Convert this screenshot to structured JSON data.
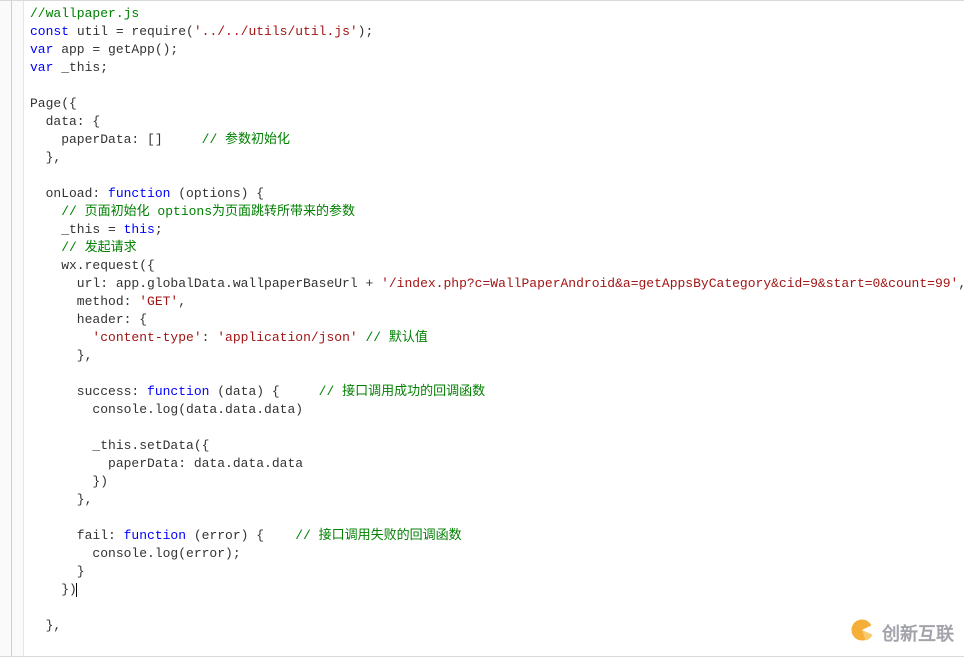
{
  "code": {
    "lines": [
      {
        "tokens": [
          {
            "c": "comment",
            "t": "//wallpaper.js"
          }
        ]
      },
      {
        "tokens": [
          {
            "c": "keyword",
            "t": "const"
          },
          {
            "c": "",
            "t": " util = require("
          },
          {
            "c": "string",
            "t": "'../../utils/util.js'"
          },
          {
            "c": "",
            "t": ");"
          }
        ]
      },
      {
        "tokens": [
          {
            "c": "keyword",
            "t": "var"
          },
          {
            "c": "",
            "t": " app = getApp();"
          }
        ]
      },
      {
        "tokens": [
          {
            "c": "keyword",
            "t": "var"
          },
          {
            "c": "",
            "t": " _this;"
          }
        ]
      },
      {
        "tokens": [
          {
            "c": "",
            "t": ""
          }
        ]
      },
      {
        "tokens": [
          {
            "c": "",
            "t": "Page({"
          }
        ]
      },
      {
        "tokens": [
          {
            "c": "",
            "t": "  data: {"
          }
        ]
      },
      {
        "tokens": [
          {
            "c": "",
            "t": "    paperData: []     "
          },
          {
            "c": "comment",
            "t": "// 参数初始化"
          }
        ]
      },
      {
        "tokens": [
          {
            "c": "",
            "t": "  },"
          }
        ]
      },
      {
        "tokens": [
          {
            "c": "",
            "t": ""
          }
        ]
      },
      {
        "tokens": [
          {
            "c": "",
            "t": "  onLoad: "
          },
          {
            "c": "keyword",
            "t": "function"
          },
          {
            "c": "",
            "t": " (options) {"
          }
        ]
      },
      {
        "tokens": [
          {
            "c": "",
            "t": "    "
          },
          {
            "c": "comment",
            "t": "// 页面初始化 options为页面跳转所带来的参数"
          }
        ]
      },
      {
        "tokens": [
          {
            "c": "",
            "t": "    _this = "
          },
          {
            "c": "keyword",
            "t": "this"
          },
          {
            "c": "",
            "t": ";"
          }
        ]
      },
      {
        "tokens": [
          {
            "c": "",
            "t": "    "
          },
          {
            "c": "comment",
            "t": "// 发起请求"
          }
        ]
      },
      {
        "tokens": [
          {
            "c": "",
            "t": "    wx.request({"
          }
        ]
      },
      {
        "tokens": [
          {
            "c": "",
            "t": "      url: app.globalData.wallpaperBaseUrl + "
          },
          {
            "c": "string",
            "t": "'/index.php?c=WallPaperAndroid&a=getAppsByCategory&cid=9&start=0&count=99'"
          },
          {
            "c": "",
            "t": ","
          }
        ]
      },
      {
        "tokens": [
          {
            "c": "",
            "t": "      method: "
          },
          {
            "c": "string",
            "t": "'GET'"
          },
          {
            "c": "",
            "t": ","
          }
        ]
      },
      {
        "tokens": [
          {
            "c": "",
            "t": "      header: {"
          }
        ]
      },
      {
        "tokens": [
          {
            "c": "",
            "t": "        "
          },
          {
            "c": "string",
            "t": "'content-type'"
          },
          {
            "c": "",
            "t": ": "
          },
          {
            "c": "string",
            "t": "'application/json'"
          },
          {
            "c": "",
            "t": " "
          },
          {
            "c": "comment",
            "t": "// 默认值"
          }
        ]
      },
      {
        "tokens": [
          {
            "c": "",
            "t": "      },"
          }
        ]
      },
      {
        "tokens": [
          {
            "c": "",
            "t": ""
          }
        ]
      },
      {
        "tokens": [
          {
            "c": "",
            "t": "      success: "
          },
          {
            "c": "keyword",
            "t": "function"
          },
          {
            "c": "",
            "t": " (data) {     "
          },
          {
            "c": "comment",
            "t": "// 接口调用成功的回调函数"
          }
        ]
      },
      {
        "tokens": [
          {
            "c": "",
            "t": "        console.log(data.data.data)"
          }
        ]
      },
      {
        "tokens": [
          {
            "c": "",
            "t": ""
          }
        ]
      },
      {
        "tokens": [
          {
            "c": "",
            "t": "        _this.setData({"
          }
        ]
      },
      {
        "tokens": [
          {
            "c": "",
            "t": "          paperData: data.data.data"
          }
        ]
      },
      {
        "tokens": [
          {
            "c": "",
            "t": "        })"
          }
        ]
      },
      {
        "tokens": [
          {
            "c": "",
            "t": "      },"
          }
        ]
      },
      {
        "tokens": [
          {
            "c": "",
            "t": ""
          }
        ]
      },
      {
        "tokens": [
          {
            "c": "",
            "t": "      fail: "
          },
          {
            "c": "keyword",
            "t": "function"
          },
          {
            "c": "",
            "t": " (error) {    "
          },
          {
            "c": "comment",
            "t": "// 接口调用失败的回调函数"
          }
        ]
      },
      {
        "tokens": [
          {
            "c": "",
            "t": "        console.log(error);"
          }
        ]
      },
      {
        "tokens": [
          {
            "c": "",
            "t": "      }"
          }
        ]
      },
      {
        "tokens": [
          {
            "c": "",
            "t": "    })"
          },
          {
            "c": "cursor",
            "t": ""
          }
        ]
      },
      {
        "tokens": [
          {
            "c": "",
            "t": ""
          }
        ]
      },
      {
        "tokens": [
          {
            "c": "",
            "t": "  },"
          }
        ]
      }
    ]
  },
  "watermark": {
    "text": "创新互联"
  }
}
